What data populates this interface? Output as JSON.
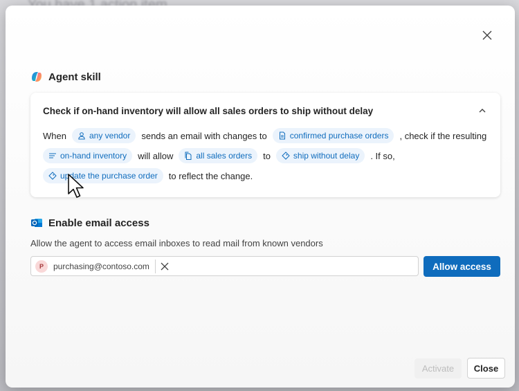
{
  "backdrop": {
    "text": "You have 1 action item"
  },
  "agent_skill": {
    "heading": "Agent skill",
    "question": "Check if on-hand inventory will allow all sales orders to ship without delay",
    "sentence": {
      "w_when": "When",
      "chip_vendor": "any vendor",
      "w_sends": "sends an email with changes to",
      "chip_confirmed": "confirmed purchase orders",
      "w_check": ", check if the resulting",
      "chip_inventory": "on-hand inventory",
      "w_will_allow": "will allow",
      "chip_sales": "all sales orders",
      "w_to": "to",
      "chip_ship": "ship without delay",
      "w_if_so": ". If so,",
      "chip_update": "update the purchase order",
      "w_reflect": "to reflect the change."
    }
  },
  "email_access": {
    "heading": "Enable email access",
    "description": "Allow the agent to access email inboxes to read mail from known vendors",
    "email_chip": {
      "avatar_initial": "P",
      "address": "purchasing@contoso.com"
    },
    "allow_button": "Allow access"
  },
  "footer": {
    "activate_label": "Activate",
    "close_label": "Close"
  },
  "colors": {
    "accent": "#0f6cbd",
    "chip_bg": "#ebf3fc"
  },
  "icons": {
    "close": "close-icon",
    "copilot": "copilot-logo-icon",
    "outlook": "outlook-icon",
    "chevron": "chevron-up-icon",
    "person": "person-icon",
    "document": "document-icon",
    "list": "list-icon",
    "documents": "documents-icon",
    "tag": "tag-icon"
  }
}
